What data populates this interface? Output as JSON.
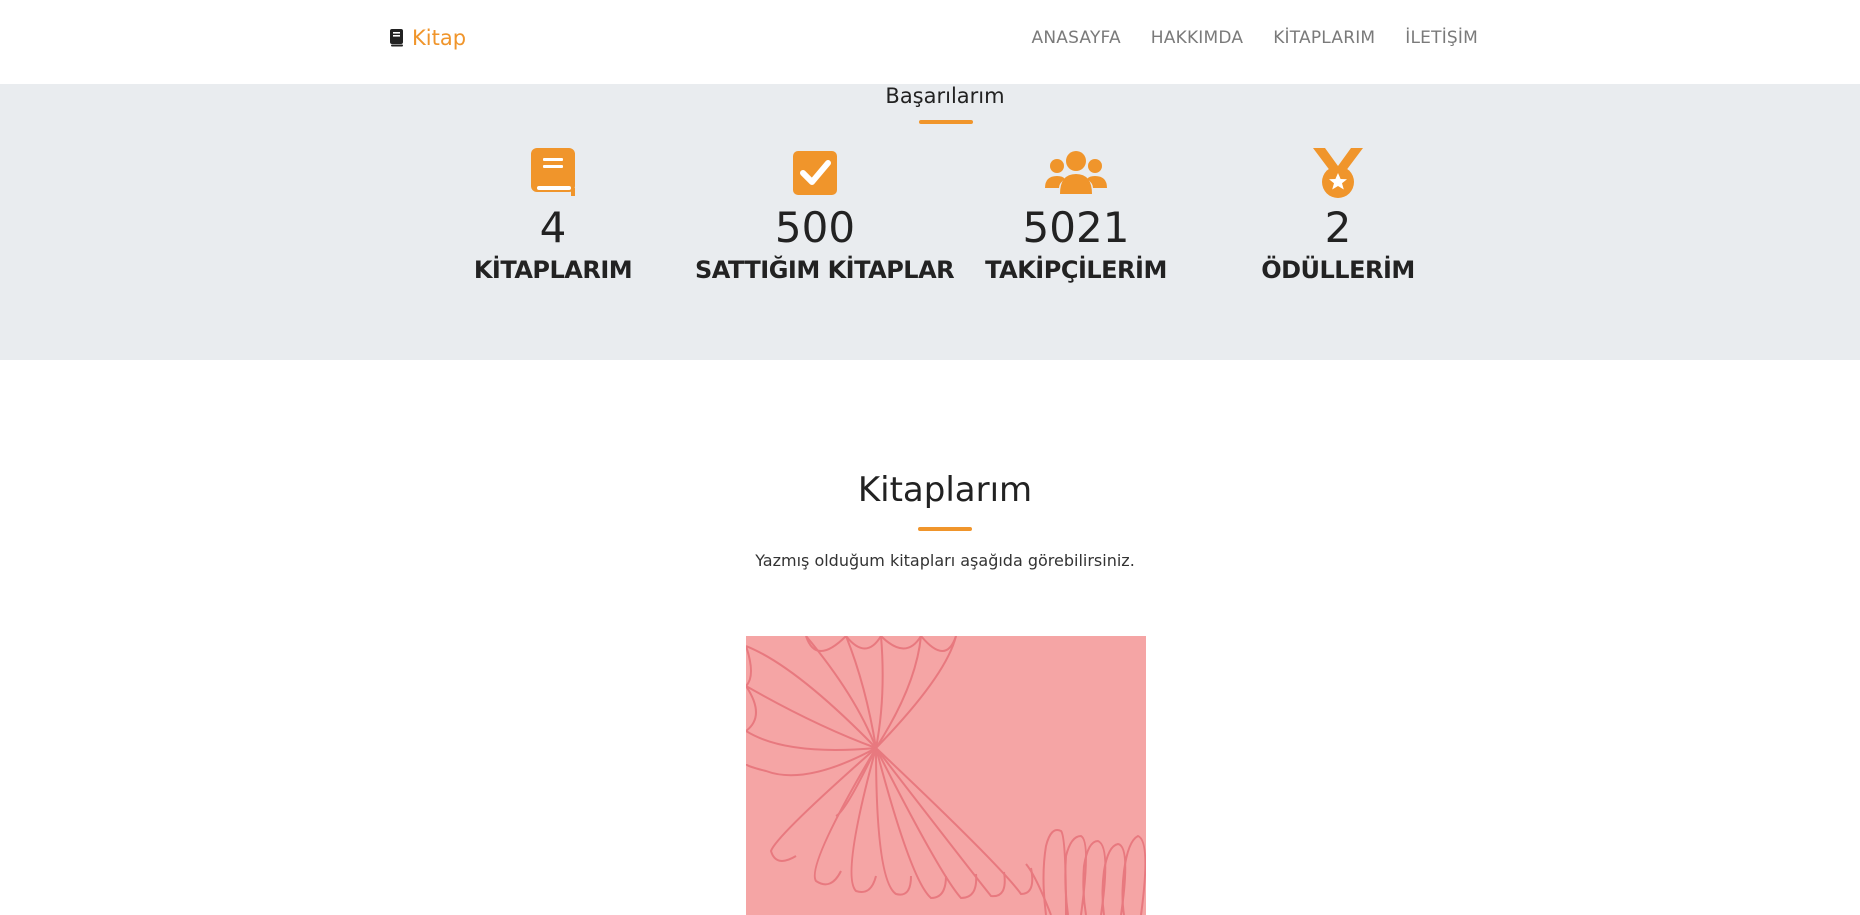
{
  "navbar": {
    "brand_label": "Kitap",
    "brand_icon": "book-icon",
    "links": [
      {
        "label": "ANASAYFA"
      },
      {
        "label": "HAKKIMDA"
      },
      {
        "label": "KİTAPLARIM"
      },
      {
        "label": "İLETİŞİM"
      }
    ]
  },
  "stats": {
    "title": "Başarılarım",
    "items": [
      {
        "icon": "book-icon",
        "number": "4",
        "label": "KİTAPLARIM"
      },
      {
        "icon": "check-square-icon",
        "number": "500",
        "label": "SATTIĞIM KİTAPLAR"
      },
      {
        "icon": "users-icon",
        "number": "5021",
        "label": "TAKİPÇİLERİM"
      },
      {
        "icon": "medal-icon",
        "number": "2",
        "label": "ÖDÜLLERİM"
      }
    ]
  },
  "books": {
    "title": "Kitaplarım",
    "description": "Yazmış olduğum kitapları aşağıda görebilirsiniz.",
    "cover_icon": "book-cover-image"
  },
  "colors": {
    "accent": "#f0952b",
    "stats_bg": "#e9ecef",
    "cover_bg": "#f5a5a5",
    "cover_line": "#e8797f"
  }
}
